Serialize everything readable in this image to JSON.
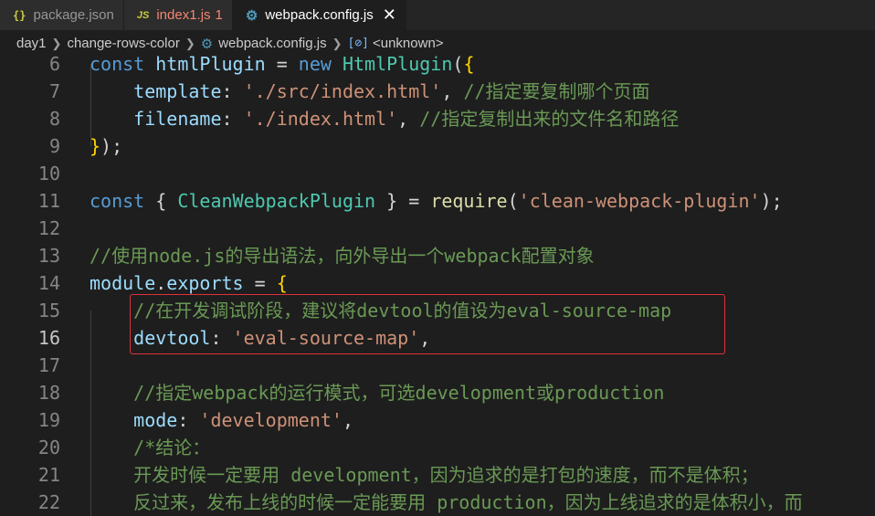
{
  "tabs": [
    {
      "icon": "{}",
      "label": "package.json",
      "badge": ""
    },
    {
      "icon": "JS",
      "label": "index1.js",
      "badge": "1"
    },
    {
      "icon": "⚙",
      "label": "webpack.config.js",
      "badge": ""
    }
  ],
  "tab_close": "✕",
  "breadcrumb": {
    "folder1": "day1",
    "folder2": "change-rows-color",
    "file": "webpack.config.js",
    "symbol_icon": "[⊘]",
    "symbol": "<unknown>"
  },
  "editor": {
    "lines": [
      {
        "n": "6",
        "segs": [
          {
            "t": "const ",
            "c": "kw"
          },
          {
            "t": "htmlPlugin",
            "c": "prop"
          },
          {
            "t": " = ",
            "c": "pun"
          },
          {
            "t": "new ",
            "c": "kw"
          },
          {
            "t": "HtmlPlugin",
            "c": "cls"
          },
          {
            "t": "(",
            "c": "pun"
          },
          {
            "t": "{",
            "c": "br"
          }
        ]
      },
      {
        "n": "7",
        "segs": [
          {
            "t": "    template",
            "c": "prop"
          },
          {
            "t": ": ",
            "c": "pun"
          },
          {
            "t": "'./src/index.html'",
            "c": "str"
          },
          {
            "t": ", ",
            "c": "pun"
          },
          {
            "t": "//指定要复制哪个页面",
            "c": "cmt"
          }
        ]
      },
      {
        "n": "8",
        "segs": [
          {
            "t": "    filename",
            "c": "prop"
          },
          {
            "t": ": ",
            "c": "pun"
          },
          {
            "t": "'./index.html'",
            "c": "str"
          },
          {
            "t": ", ",
            "c": "pun"
          },
          {
            "t": "//指定复制出来的文件名和路径",
            "c": "cmt"
          }
        ]
      },
      {
        "n": "9",
        "segs": [
          {
            "t": "}",
            "c": "br"
          },
          {
            "t": ");",
            "c": "pun"
          }
        ]
      },
      {
        "n": "10",
        "segs": []
      },
      {
        "n": "11",
        "segs": [
          {
            "t": "const ",
            "c": "kw"
          },
          {
            "t": "{ ",
            "c": "pun"
          },
          {
            "t": "CleanWebpackPlugin",
            "c": "cls"
          },
          {
            "t": " } = ",
            "c": "pun"
          },
          {
            "t": "require",
            "c": "fn"
          },
          {
            "t": "(",
            "c": "pun"
          },
          {
            "t": "'clean-webpack-plugin'",
            "c": "str"
          },
          {
            "t": ");",
            "c": "pun"
          }
        ]
      },
      {
        "n": "12",
        "segs": []
      },
      {
        "n": "13",
        "segs": [
          {
            "t": "//使用node.js的导出语法，向外导出一个webpack配置对象",
            "c": "cmt"
          }
        ]
      },
      {
        "n": "14",
        "segs": [
          {
            "t": "module",
            "c": "prop"
          },
          {
            "t": ".",
            "c": "pun"
          },
          {
            "t": "exports",
            "c": "prop"
          },
          {
            "t": " = ",
            "c": "pun"
          },
          {
            "t": "{",
            "c": "br"
          }
        ]
      },
      {
        "n": "15",
        "segs": [
          {
            "t": "    //在开发调试阶段，建议将devtool的值设为eval-source-map",
            "c": "cmt"
          }
        ]
      },
      {
        "n": "16",
        "segs": [
          {
            "t": "    devtool",
            "c": "prop"
          },
          {
            "t": ": ",
            "c": "pun"
          },
          {
            "t": "'eval-source-map'",
            "c": "str"
          },
          {
            "t": ",",
            "c": "pun"
          }
        ]
      },
      {
        "n": "17",
        "segs": []
      },
      {
        "n": "18",
        "segs": [
          {
            "t": "    //指定webpack的运行模式，可选development或production",
            "c": "cmt"
          }
        ]
      },
      {
        "n": "19",
        "segs": [
          {
            "t": "    mode",
            "c": "prop"
          },
          {
            "t": ": ",
            "c": "pun"
          },
          {
            "t": "'development'",
            "c": "str"
          },
          {
            "t": ",",
            "c": "pun"
          }
        ]
      },
      {
        "n": "20",
        "segs": [
          {
            "t": "    /*结论：",
            "c": "cmt"
          }
        ]
      },
      {
        "n": "21",
        "segs": [
          {
            "t": "    开发时候一定要用 development，因为追求的是打包的速度，而不是体积；",
            "c": "cmt"
          }
        ]
      },
      {
        "n": "22",
        "segs": [
          {
            "t": "    反过来，发布上线的时候一定能要用 production，因为上线追求的是体积小，而",
            "c": "cmt"
          }
        ]
      }
    ],
    "current_line": "16"
  },
  "colors": {
    "background": "#1e1e1e",
    "highlight_box": "#e0313b",
    "tab_bar": "#252526"
  }
}
